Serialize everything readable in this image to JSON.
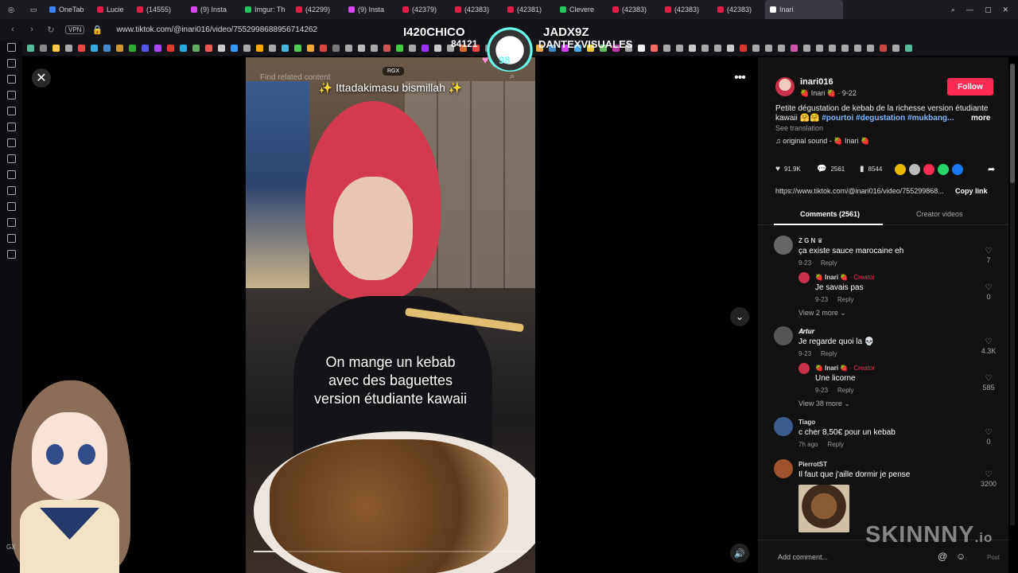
{
  "tabs": [
    {
      "label": "OneTab",
      "color": "#3b82f6"
    },
    {
      "label": "Lucie",
      "color": "#e11d48"
    },
    {
      "label": "(14555)",
      "color": "#e11d48"
    },
    {
      "label": "(9) Insta",
      "color": "#d946ef"
    },
    {
      "label": "Imgur: Th",
      "color": "#22c55e"
    },
    {
      "label": "(42299)",
      "color": "#e11d48"
    },
    {
      "label": "(9) Insta",
      "color": "#d946ef"
    },
    {
      "label": "(42379)",
      "color": "#e11d48"
    },
    {
      "label": "(42383)",
      "color": "#e11d48"
    },
    {
      "label": "(42381)",
      "color": "#e11d48"
    },
    {
      "label": "Clevere",
      "color": "#22c55e"
    },
    {
      "label": "(42383)",
      "color": "#e11d48"
    },
    {
      "label": "(42383)",
      "color": "#e11d48"
    },
    {
      "label": "(42383)",
      "color": "#e11d48"
    },
    {
      "label": "Inari",
      "color": "#fff"
    }
  ],
  "address": {
    "vpn": "VPN",
    "url": "www.tiktok.com/@inari016/video/7552998688956714262"
  },
  "overlay": {
    "left_name": "I420CHICO",
    "right_name": "JADX9Z",
    "count": "84121",
    "sub_name": "DANTEXVISUALES",
    "heart": "♥",
    "heart_count": "98"
  },
  "video": {
    "search_placeholder": "Find related content",
    "badge": "RGX",
    "title": "✨ Ittadakimasu bismillah ✨",
    "caption": [
      "On mange un kebab",
      "avec des baguettes",
      "version étudiante kawaii"
    ],
    "progress": 0.08
  },
  "controls": {
    "close": "✕",
    "more": "•••",
    "next": "⌄",
    "mute": "🔊"
  },
  "author": {
    "name": "inari016",
    "sub": "🍓 Inari 🍓 · 9-22",
    "follow": "Follow",
    "description": "Petite dégustation de kebab de la richesse version étudiante kawaii 🤗🤗",
    "tags": "#pourtoi #degustation #mukbang...",
    "more": "more",
    "see_translation": "See translation",
    "sound": "♫  original sound - 🍓 Inari 🍓"
  },
  "stats": {
    "likes": "91.9K",
    "comments": "2561",
    "saves": "8544"
  },
  "share_colors": [
    "#e6b800",
    "#bbbbbb",
    "#fe2c55",
    "#25d366",
    "#1877f2"
  ],
  "link": {
    "url": "https://www.tiktok.com/@inari016/video/755299868...",
    "copy": "Copy link"
  },
  "panel_tabs": {
    "comments": "Comments (2561)",
    "creator": "Creator videos"
  },
  "comments": [
    {
      "name": "Z G N ♛",
      "text": "ça existe sauce marocaine eh",
      "date": "9-23",
      "reply": "Reply",
      "likes": "7",
      "avatar": "#666"
    },
    {
      "name": "🍓 Inari 🍓",
      "creator": " · Creator",
      "text": "Je savais pas",
      "date": "9-23",
      "reply": "Reply",
      "likes": "0",
      "avatar": "#c9314a"
    },
    {
      "name": "𝑨𝒓𝒕𝒖𝒓",
      "text": "Je regarde quoi la 💀",
      "date": "9-23",
      "reply": "Reply",
      "likes": "4.3K",
      "avatar": "#555"
    },
    {
      "name": "🍓 Inari 🍓",
      "creator": " · Creator",
      "text": "Une licorne",
      "date": "9-23",
      "reply": "Reply",
      "likes": "585",
      "avatar": "#c9314a"
    },
    {
      "name": "Tiago",
      "text": "c cher 8,50€ pour un kebab",
      "date": "7h ago",
      "reply": "Reply",
      "likes": "0",
      "avatar": "#3b5b8e"
    },
    {
      "name": "PierrotST",
      "text": "Il faut que j'aille dormir je pense",
      "date": "",
      "reply": "",
      "likes": "3200",
      "avatar": "#a0522d"
    }
  ],
  "view_more": [
    "View 2 more ⌄",
    "View 38 more ⌄"
  ],
  "add_comment": {
    "placeholder": "Add comment...",
    "at": "@",
    "emoji": "☺",
    "post": "Post"
  },
  "watermark": {
    "main": "SKINNNY",
    "suffix": ".io"
  },
  "gx": "GX"
}
